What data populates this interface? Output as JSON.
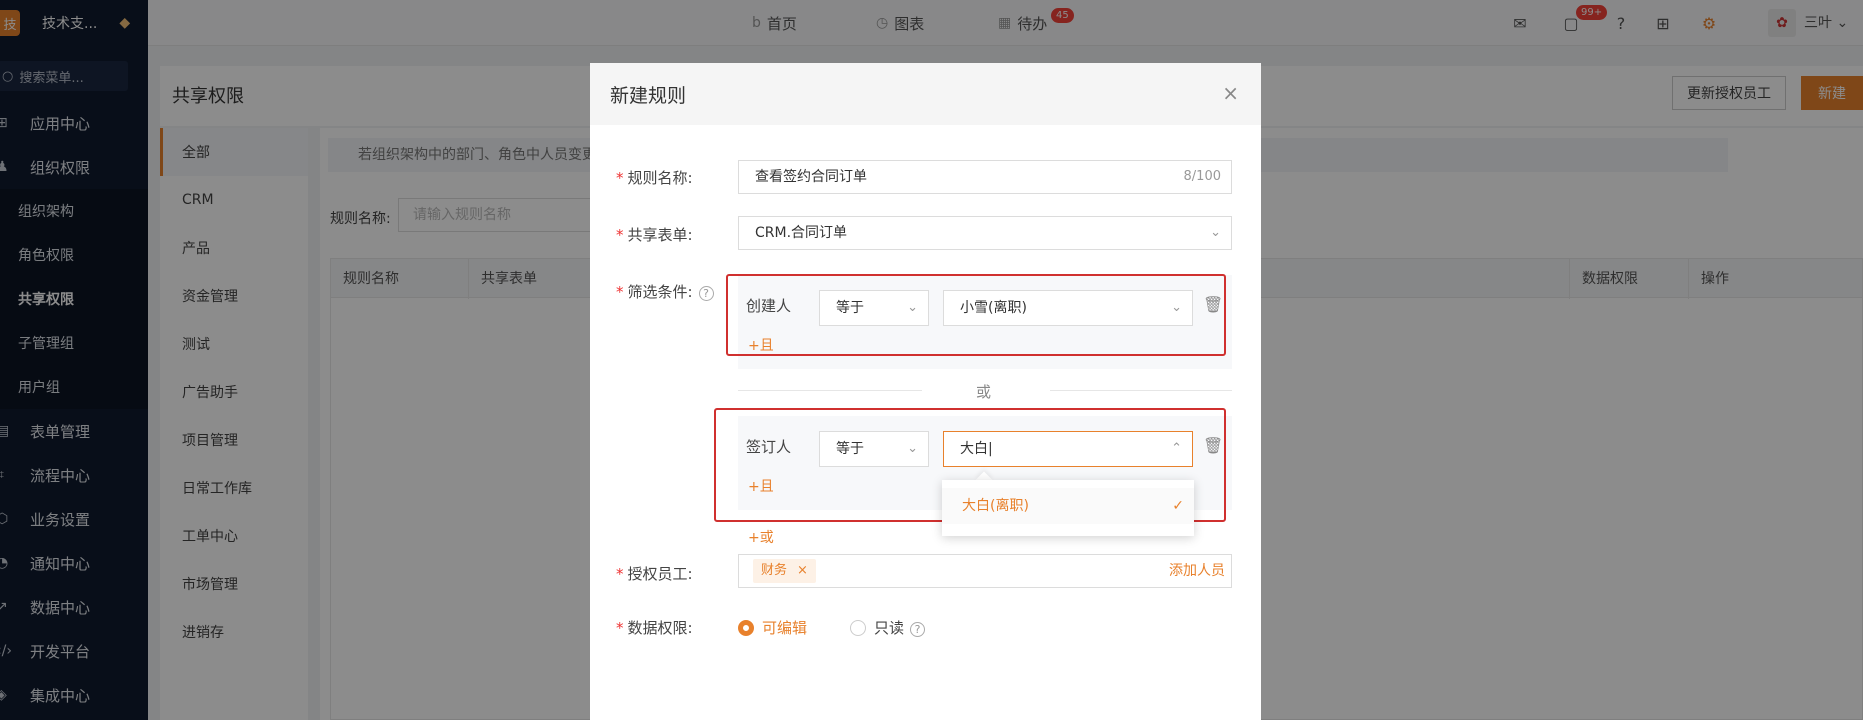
{
  "sidebar": {
    "logo_char": "技",
    "brand": "技术支...",
    "search_placeholder": "搜索菜单...",
    "menu": [
      {
        "label": "应用中心",
        "icon": "grid-icon"
      },
      {
        "label": "组织权限",
        "icon": "user-icon"
      }
    ],
    "submenu": [
      {
        "label": "组织架构"
      },
      {
        "label": "角色权限"
      },
      {
        "label": "共享权限"
      },
      {
        "label": "子管理组"
      },
      {
        "label": "用户组"
      }
    ],
    "menu2": [
      {
        "label": "表单管理",
        "icon": "form-icon"
      },
      {
        "label": "流程中心",
        "icon": "flow-icon"
      },
      {
        "label": "业务设置",
        "icon": "cube-icon"
      },
      {
        "label": "通知中心",
        "icon": "bell-icon"
      },
      {
        "label": "数据中心",
        "icon": "chart-icon"
      },
      {
        "label": "开发平台",
        "icon": "code-icon"
      },
      {
        "label": "集成中心",
        "icon": "layers-icon"
      }
    ]
  },
  "topbar": {
    "home": "首页",
    "charts": "图表",
    "todo": "待办",
    "todo_badge": "45",
    "msg_badge": "99+",
    "user": "三叶"
  },
  "page": {
    "title": "共享权限",
    "update_button": "更新授权员工",
    "new_button": "新建",
    "categories": [
      "全部",
      "CRM",
      "产品",
      "资金管理",
      "测试",
      "广告助手",
      "项目管理",
      "日常工作库",
      "工单中心",
      "市场管理",
      "进销存"
    ],
    "notice": "若组织架构中的部门、角色中人员变更",
    "filter_label": "规则名称:",
    "filter_placeholder": "请输入规则名称",
    "columns": [
      "规则名称",
      "共享表单",
      "数据权限",
      "操作"
    ]
  },
  "modal": {
    "title": "新建规则",
    "rule_name_label": "规则名称:",
    "rule_name_value": "查看签约合同订单",
    "rule_name_count": "8/100",
    "form_label": "共享表单:",
    "form_value": "CRM.合同订单",
    "filter_label": "筛选条件:",
    "cond1": {
      "field": "创建人",
      "op": "等于",
      "value": "小雪(离职)",
      "add": "+且"
    },
    "or_text": "或",
    "cond2": {
      "field": "签订人",
      "op": "等于",
      "value": "大白",
      "add": "+且"
    },
    "add_or": "+或",
    "dropdown_option": "大白(离职)",
    "staff_label": "授权员工:",
    "staff_tag": "财务",
    "add_person": "添加人员",
    "perm_label": "数据权限:",
    "perm_edit": "可编辑",
    "perm_read": "只读"
  }
}
